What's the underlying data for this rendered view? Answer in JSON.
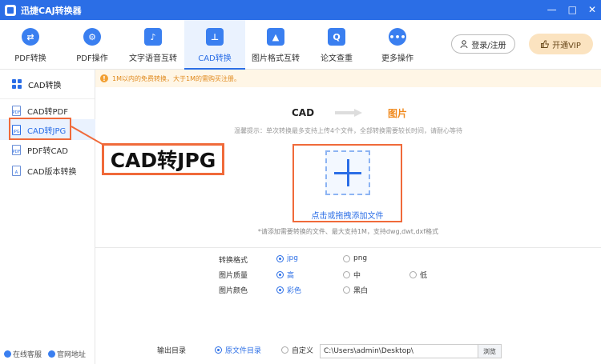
{
  "titlebar": {
    "title": "迅捷CAJ转换器",
    "min": "—",
    "max": "□",
    "close": "✕"
  },
  "toolbar": {
    "tools": [
      {
        "label": "PDF转换",
        "icon": "⇄"
      },
      {
        "label": "PDF操作",
        "icon": "⚙"
      },
      {
        "label": "文字语音互转",
        "icon": "♪"
      },
      {
        "label": "CAD转换",
        "icon": "⊥"
      },
      {
        "label": "图片格式互转",
        "icon": "▲"
      },
      {
        "label": "论文查重",
        "icon": "Q"
      },
      {
        "label": "更多操作",
        "icon": "•••"
      }
    ],
    "login_label": "登录/注册",
    "vip_label": "开通VIP"
  },
  "sidebar": {
    "header": "CAD转换",
    "items": [
      {
        "label": "CAD转PDF",
        "icon_text": "PDF"
      },
      {
        "label": "CAD转JPG",
        "icon_text": "JPG"
      },
      {
        "label": "PDF转CAD",
        "icon_text": "PDF"
      },
      {
        "label": "CAD版本转换",
        "icon_text": "A"
      }
    ],
    "footer": {
      "service": "在线客服",
      "website": "官网地址"
    }
  },
  "notice": {
    "icon": "!",
    "text": "1M以内的免费转换，大于1M的需购买注册。"
  },
  "main": {
    "flow_from": "CAD",
    "flow_to": "图片",
    "hint": "温馨提示：单次转换最多支持上传4个文件，全部转换需要较长时间，请耐心等待",
    "dropzone_label": "点击或拖拽添加文件",
    "dropzone_note": "*请添加需要转换的文件、最大支持1M，支持dwg,dwt,dxf格式"
  },
  "options": {
    "format": {
      "label": "转换格式",
      "choices": [
        "jpg",
        "png"
      ],
      "selected": "jpg"
    },
    "quality": {
      "label": "图片质量",
      "choices": [
        "高",
        "中",
        "低"
      ],
      "selected": "高"
    },
    "color": {
      "label": "图片颜色",
      "choices": [
        "彩色",
        "黑白"
      ],
      "selected": "彩色"
    }
  },
  "output": {
    "label": "输出目录",
    "source_dir": "原文件目录",
    "custom": "自定义",
    "path": "C:\\Users\\admin\\Desktop\\",
    "browse": "浏览"
  },
  "callout": {
    "text": "CAD转JPG"
  },
  "colors": {
    "brand": "#2b6ee6",
    "accent_orange": "#f06a3a",
    "notice_text": "#e08a1e"
  }
}
